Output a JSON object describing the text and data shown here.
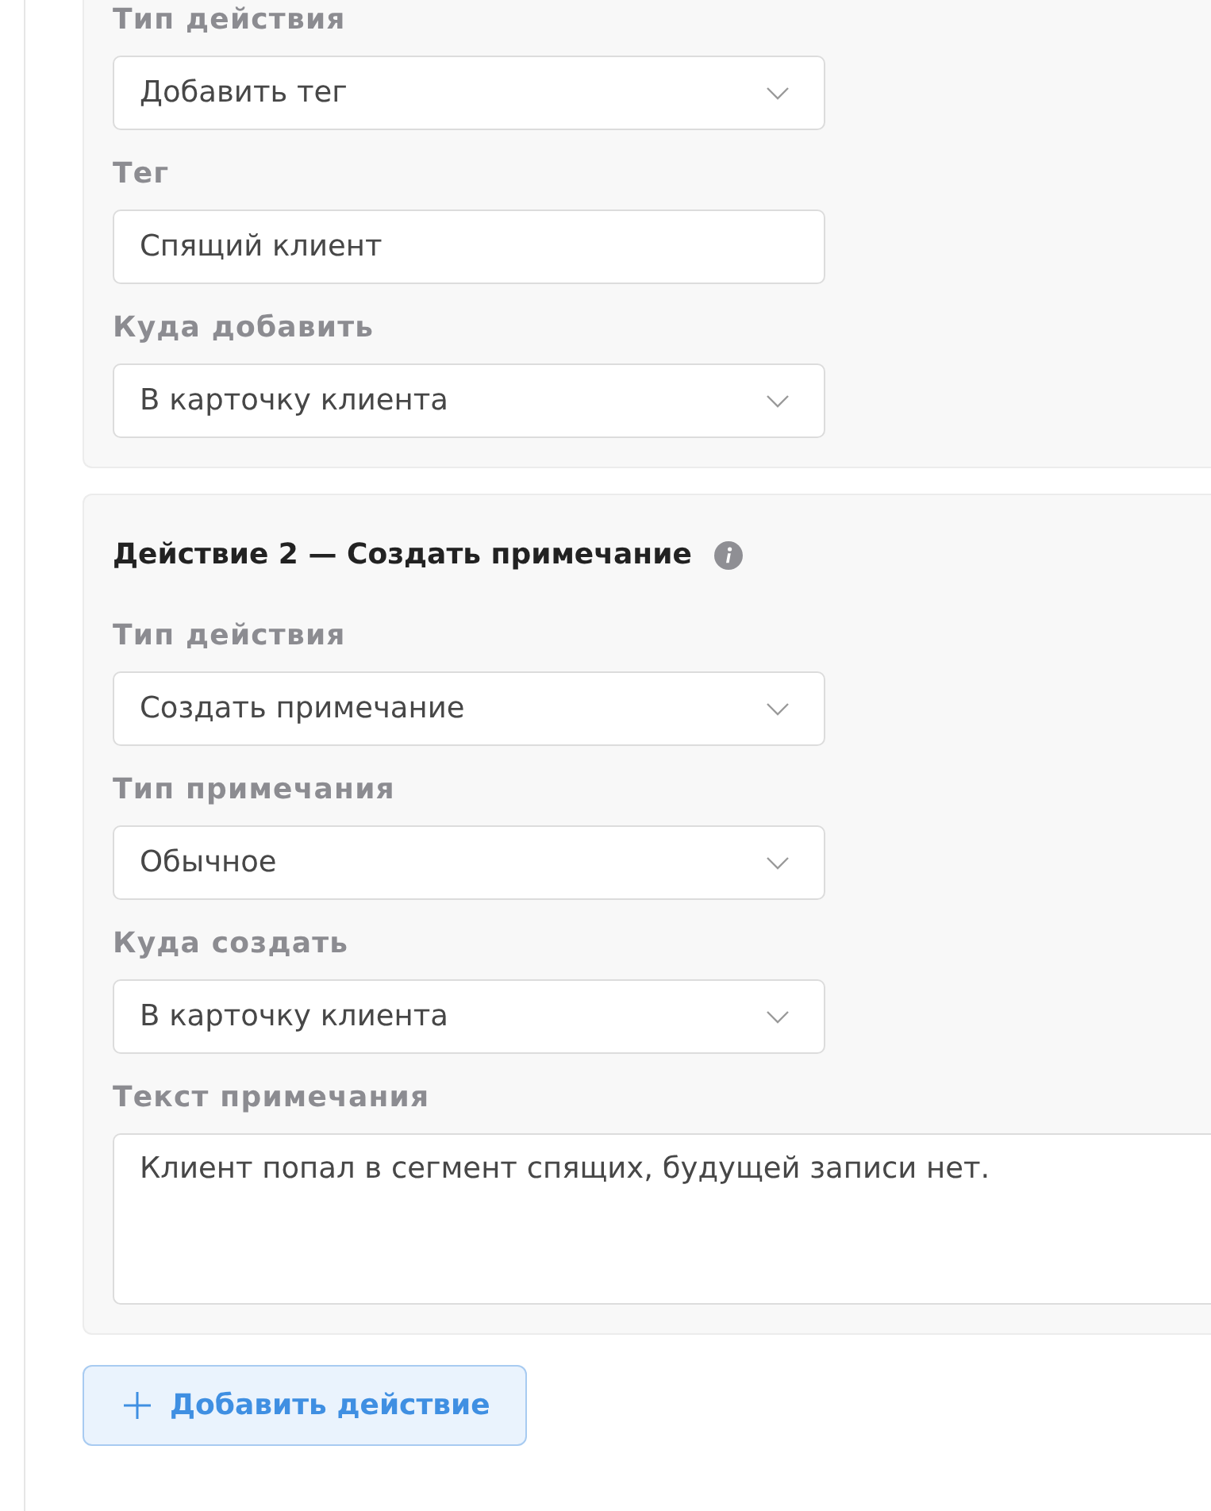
{
  "actions": [
    {
      "fields": [
        {
          "kind": "select",
          "label": "Тип действия",
          "value": "Добавить тег"
        },
        {
          "kind": "text",
          "label": "Тег",
          "value": "Спящий клиент"
        },
        {
          "kind": "select",
          "label": "Куда добавить",
          "value": "В карточку клиента"
        }
      ]
    },
    {
      "title": "Действие 2 — Создать примечание",
      "fields": [
        {
          "kind": "select",
          "label": "Тип действия",
          "value": "Создать примечание"
        },
        {
          "kind": "select",
          "label": "Тип примечания",
          "value": "Обычное"
        },
        {
          "kind": "select",
          "label": "Куда создать",
          "value": "В карточку клиента"
        },
        {
          "kind": "textarea",
          "label": "Текст примечания",
          "value": "Клиент попал в сегмент спящих, будущей записи нет."
        }
      ]
    }
  ],
  "add_action_button": {
    "label": "Добавить действие"
  }
}
